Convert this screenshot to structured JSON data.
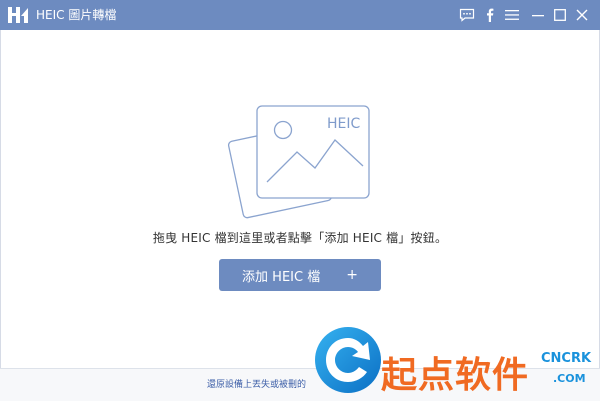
{
  "window": {
    "title": "HEIC 圖片轉檔"
  },
  "titlebar_icons": [
    "chat-icon",
    "facebook-icon",
    "menu-icon",
    "minimize-icon",
    "maximize-icon",
    "close-icon"
  ],
  "illustration": {
    "label": "HEIC"
  },
  "main": {
    "hint": "拖曳 HEIC 檔到這里或者點擊「添加 HEIC 檔」按鈕。",
    "add_button_label": "添加 HEIC 檔",
    "add_button_icon": "+"
  },
  "footer": {
    "recover_link": "還原設備上丟失或被刪的"
  },
  "watermark": {
    "brand_text": "起点软件",
    "site_top": "CNCRK",
    "site_bottom": ".COM"
  },
  "colors": {
    "accent": "#6d8bc0",
    "watermark_orange": "#f06a22",
    "watermark_blue": "#1a92dc"
  }
}
